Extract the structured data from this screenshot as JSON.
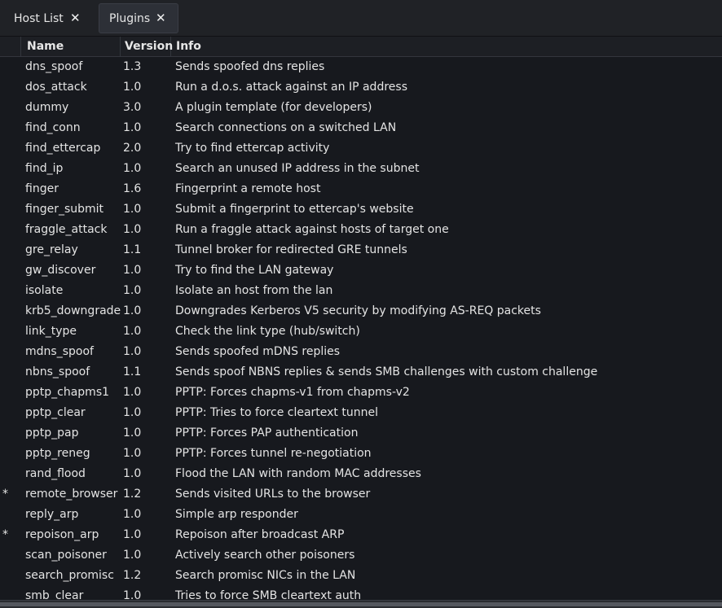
{
  "tabs": [
    {
      "label": "Host List",
      "close": "✕"
    },
    {
      "label": "Plugins",
      "close": "✕"
    }
  ],
  "columns": {
    "mark": "",
    "name": "Name",
    "version": "Version",
    "info": "Info"
  },
  "plugins": [
    {
      "mark": "",
      "name": "dns_spoof",
      "version": "1.3",
      "info": "Sends spoofed dns replies"
    },
    {
      "mark": "",
      "name": "dos_attack",
      "version": "1.0",
      "info": "Run a d.o.s. attack against an IP address"
    },
    {
      "mark": "",
      "name": "dummy",
      "version": "3.0",
      "info": "A plugin template (for developers)"
    },
    {
      "mark": "",
      "name": "find_conn",
      "version": "1.0",
      "info": "Search connections on a switched LAN"
    },
    {
      "mark": "",
      "name": "find_ettercap",
      "version": "2.0",
      "info": "Try to find ettercap activity"
    },
    {
      "mark": "",
      "name": "find_ip",
      "version": "1.0",
      "info": "Search an unused IP address in the subnet"
    },
    {
      "mark": "",
      "name": "finger",
      "version": "1.6",
      "info": "Fingerprint a remote host"
    },
    {
      "mark": "",
      "name": "finger_submit",
      "version": "1.0",
      "info": "Submit a fingerprint to ettercap's website"
    },
    {
      "mark": "",
      "name": "fraggle_attack",
      "version": "1.0",
      "info": "Run a fraggle attack against hosts of target one"
    },
    {
      "mark": "",
      "name": "gre_relay",
      "version": "1.1",
      "info": "Tunnel broker for redirected GRE tunnels"
    },
    {
      "mark": "",
      "name": "gw_discover",
      "version": "1.0",
      "info": "Try to find the LAN gateway"
    },
    {
      "mark": "",
      "name": "isolate",
      "version": "1.0",
      "info": "Isolate an host from the lan"
    },
    {
      "mark": "",
      "name": "krb5_downgrade",
      "version": "1.0",
      "info": "Downgrades Kerberos V5 security by modifying AS-REQ packets"
    },
    {
      "mark": "",
      "name": "link_type",
      "version": "1.0",
      "info": "Check the link type (hub/switch)"
    },
    {
      "mark": "",
      "name": "mdns_spoof",
      "version": "1.0",
      "info": "Sends spoofed mDNS replies"
    },
    {
      "mark": "",
      "name": "nbns_spoof",
      "version": "1.1",
      "info": "Sends spoof NBNS replies & sends SMB challenges with custom challenge"
    },
    {
      "mark": "",
      "name": "pptp_chapms1",
      "version": "1.0",
      "info": "PPTP: Forces chapms-v1 from chapms-v2"
    },
    {
      "mark": "",
      "name": "pptp_clear",
      "version": "1.0",
      "info": "PPTP: Tries to force cleartext tunnel"
    },
    {
      "mark": "",
      "name": "pptp_pap",
      "version": "1.0",
      "info": "PPTP: Forces PAP authentication"
    },
    {
      "mark": "",
      "name": "pptp_reneg",
      "version": "1.0",
      "info": "PPTP: Forces tunnel re-negotiation"
    },
    {
      "mark": "",
      "name": "rand_flood",
      "version": "1.0",
      "info": "Flood the LAN with random MAC addresses"
    },
    {
      "mark": "*",
      "name": "remote_browser",
      "version": "1.2",
      "info": "Sends visited URLs to the browser"
    },
    {
      "mark": "",
      "name": "reply_arp",
      "version": "1.0",
      "info": "Simple arp responder"
    },
    {
      "mark": "*",
      "name": "repoison_arp",
      "version": "1.0",
      "info": "Repoison after broadcast ARP"
    },
    {
      "mark": "",
      "name": "scan_poisoner",
      "version": "1.0",
      "info": "Actively search other poisoners"
    },
    {
      "mark": "",
      "name": "search_promisc",
      "version": "1.2",
      "info": "Search promisc NICs in the LAN"
    },
    {
      "mark": "",
      "name": "smb_clear",
      "version": "1.0",
      "info": "Tries to force SMB cleartext auth"
    }
  ]
}
